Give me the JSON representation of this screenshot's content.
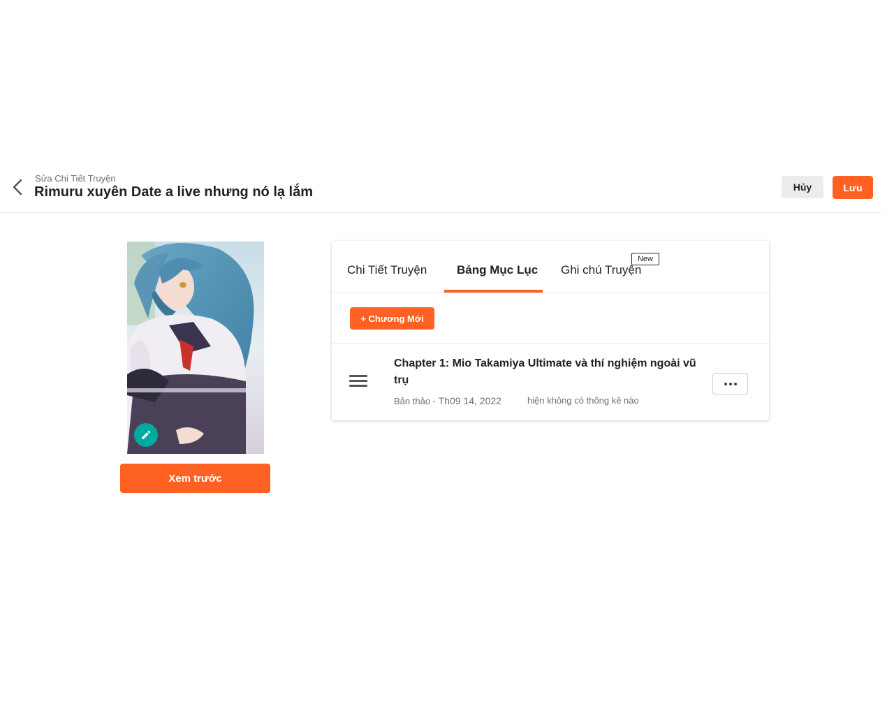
{
  "header": {
    "subtitle": "Sửa Chi Tiết Truyện",
    "title": "Rimuru xuyên Date a live nhưng nó lạ lắm",
    "cancel_label": "Hủy",
    "save_label": "Lưu",
    "back_icon": "chevron-left-icon"
  },
  "cover": {
    "edit_icon": "pencil-icon",
    "preview_label": "Xem trước"
  },
  "tabs": [
    {
      "label": "Chi Tiết Truyện",
      "active": false
    },
    {
      "label": "Bảng Mục Lục",
      "active": true
    },
    {
      "label": "Ghi chú Truyện",
      "active": false,
      "badge": "New"
    }
  ],
  "toolbar": {
    "new_chapter_label": "+ Chương Mới"
  },
  "chapters": [
    {
      "title": "Chapter 1: Mio Takamiya Ultimate và thí nghiệm ngoài vũ trụ",
      "status": "Bản thảo -",
      "date": "Th09 14, 2022",
      "stats": "hiện không có thống kê nào"
    }
  ],
  "colors": {
    "accent": "#ff6122",
    "edit_button": "#00a99d"
  }
}
